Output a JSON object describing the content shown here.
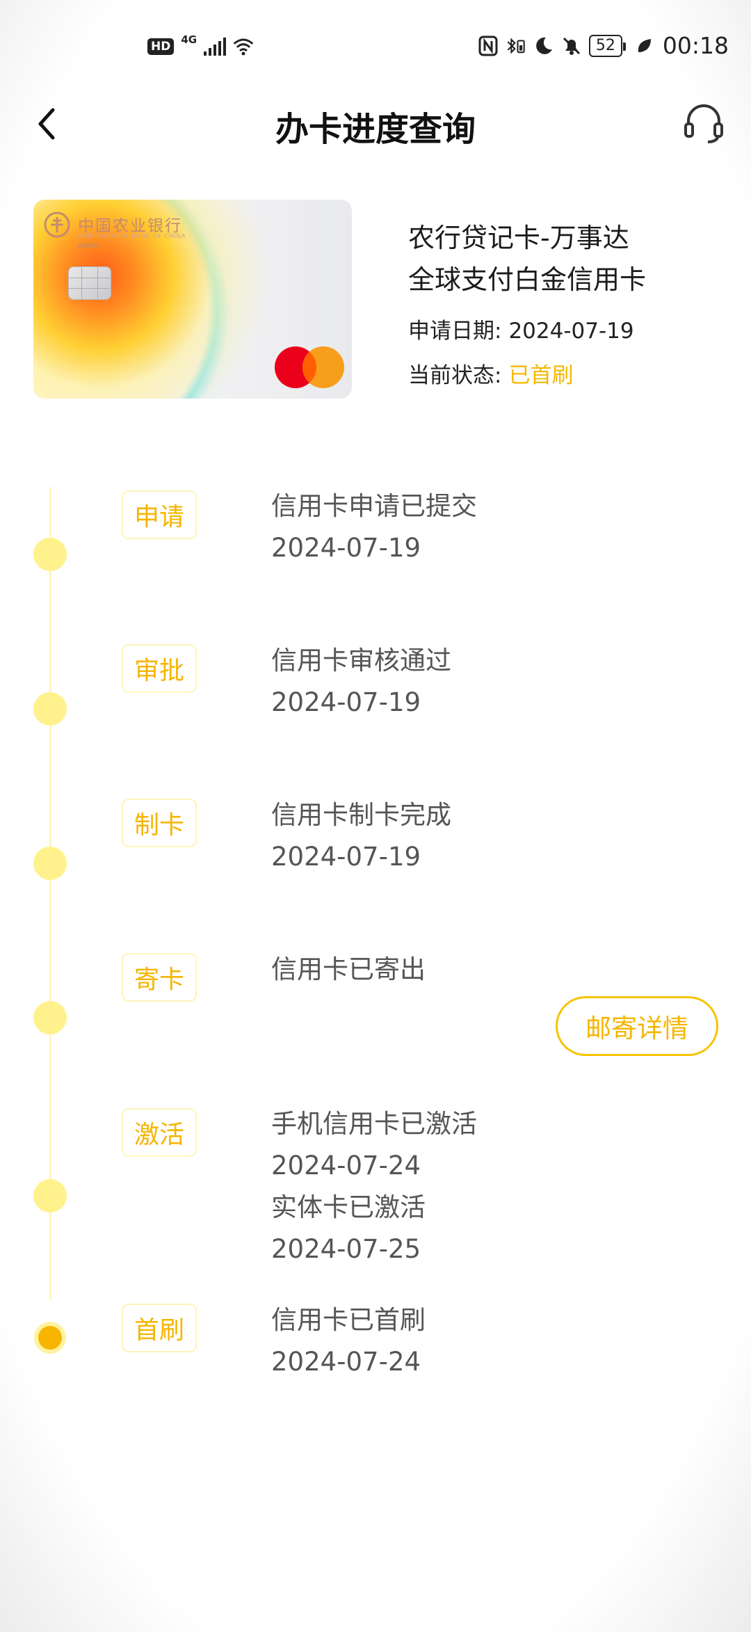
{
  "status_bar": {
    "hd": "HD",
    "network": "4G",
    "battery": "52",
    "time": "00:18"
  },
  "header": {
    "title": "办卡进度查询",
    "back_icon": "chevron-left-icon",
    "service_icon": "headset-icon"
  },
  "card": {
    "bank_name": "中国农业银行",
    "bank_name_en": "AGRICULTURAL BANK OF CHINA",
    "credit_text": "CREDIT",
    "name_line1": "农行贷记卡-万事达",
    "name_line2": "全球支付白金信用卡",
    "apply_date_label": "申请日期:",
    "apply_date": "2024-07-19",
    "status_label": "当前状态:",
    "status_value": "已首刷"
  },
  "colors": {
    "accent": "#f5b500",
    "dot": "#fff28c",
    "line": "#fff6bf"
  },
  "steps": [
    {
      "tag": "申请",
      "lines": [
        "信用卡申请已提交",
        "2024-07-19"
      ]
    },
    {
      "tag": "审批",
      "lines": [
        "信用卡审核通过",
        "2024-07-19"
      ]
    },
    {
      "tag": "制卡",
      "lines": [
        "信用卡制卡完成",
        "2024-07-19"
      ]
    },
    {
      "tag": "寄卡",
      "lines": [
        "信用卡已寄出"
      ],
      "button": "邮寄详情"
    },
    {
      "tag": "激活",
      "lines": [
        "手机信用卡已激活",
        "2024-07-24",
        "实体卡已激活",
        "2024-07-25"
      ]
    },
    {
      "tag": "首刷",
      "lines": [
        "信用卡已首刷",
        "2024-07-24"
      ]
    }
  ]
}
